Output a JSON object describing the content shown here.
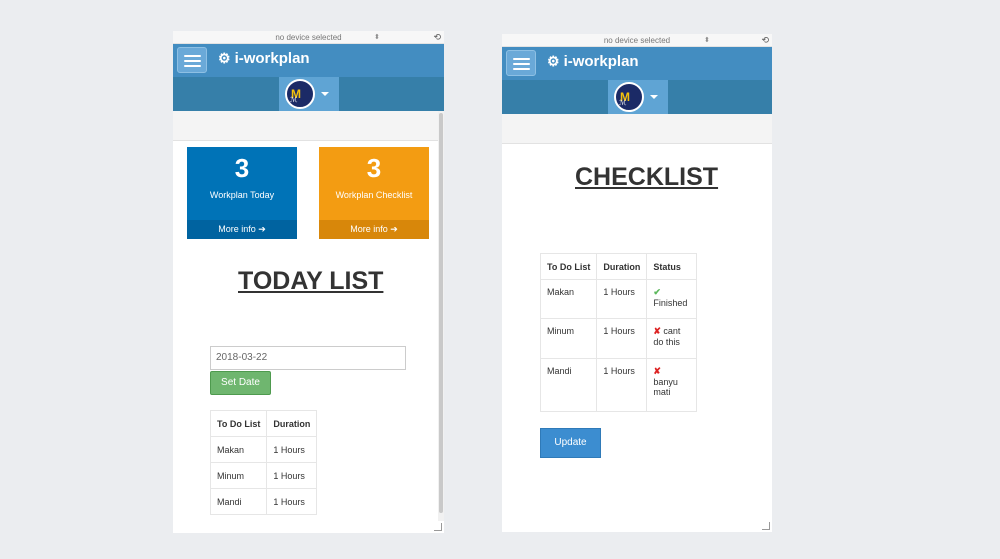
{
  "device_bar": "no device selected",
  "app": {
    "title": "i-workplan"
  },
  "boxes": [
    {
      "value": "3",
      "label": "Workplan Today",
      "more": "More info"
    },
    {
      "value": "3",
      "label": "Workplan Checklist",
      "more": "More info"
    }
  ],
  "today": {
    "heading": "TODAY LIST",
    "date_value": "2018-03-22",
    "set_date_label": "Set Date",
    "columns": [
      "To Do List",
      "Duration"
    ],
    "rows": [
      [
        "Makan",
        "1 Hours"
      ],
      [
        "Minum",
        "1 Hours"
      ],
      [
        "Mandi",
        "1 Hours"
      ]
    ]
  },
  "checklist": {
    "heading": "CHECKLIST",
    "columns": [
      "To Do List",
      "Duration",
      "Status"
    ],
    "rows": [
      {
        "task": "Makan",
        "duration": "1 Hours",
        "status_icon": "✔",
        "status": "Finished"
      },
      {
        "task": "Minum",
        "duration": "1 Hours",
        "status_icon": "✘",
        "status": "cant do this"
      },
      {
        "task": "Mandi",
        "duration": "1 Hours",
        "status_icon": "✘",
        "status": "banyu mati"
      }
    ],
    "update_label": "Update"
  },
  "colors": {
    "navbar": "#438dc1",
    "subnav": "#367fa9",
    "box_blue": "#0073b7",
    "box_orange": "#f39c12",
    "set_date": "#6fb66f",
    "update": "#3c8dd0"
  }
}
